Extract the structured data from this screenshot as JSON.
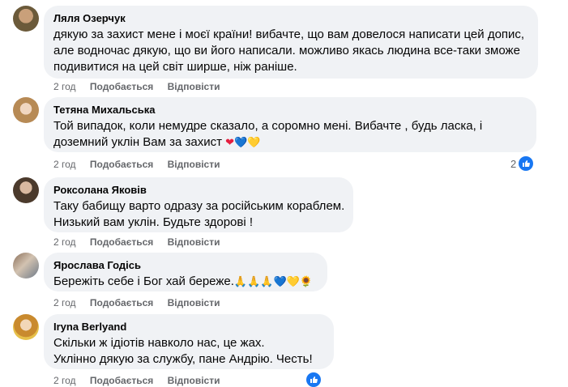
{
  "comments": [
    {
      "author": "Ляля Озерчук",
      "lines": [
        "дякую за захист мене і моєї країни! вибачте, що вам довелося написати цей допис,",
        "але водночас дякую, що ви його написали. можливо якась людина все-таки зможе",
        "подивитися на цей світ ширше, ніж раніше."
      ],
      "time": "2 год",
      "like": "Подобається",
      "reply": "Відповісти"
    },
    {
      "author": "Тетяна Михальська",
      "lines": [
        "Той випадок, коли немудре сказало, а соромно мені. Вибачте , будь ласка, і",
        "доземний уклін Вам за захист"
      ],
      "emojis": [
        "❤",
        "💙",
        "💛"
      ],
      "time": "2 год",
      "like": "Подобається",
      "reply": "Відповісти",
      "reaction_count": "2"
    },
    {
      "author": "Роксолана Яковів",
      "lines": [
        "Таку бабищу варто одразу за російським кораблем.",
        "Низький вам уклін. Будьте здорові !"
      ],
      "time": "2 год",
      "like": "Подобається",
      "reply": "Відповісти"
    },
    {
      "author": "Ярослава Годісь",
      "lines": [
        "Бережіть себе і Бог хай береже."
      ],
      "emojis": [
        "🙏",
        "🙏",
        "🙏",
        "💙",
        "💛",
        "🌻"
      ],
      "time": "2 год",
      "like": "Подобається",
      "reply": "Відповісти"
    },
    {
      "author": "Iryna Berlyand",
      "lines": [
        "Скільки ж ідіотів навколо нас, це жах.",
        "Уклінно дякую за службу, пане Андрію. Честь!"
      ],
      "time": "2 год",
      "like": "Подобається",
      "reply": "Відповісти"
    }
  ],
  "colors": {
    "bubble": "#f0f2f5",
    "meta": "#65676b",
    "like_blue": "#1877f2"
  }
}
